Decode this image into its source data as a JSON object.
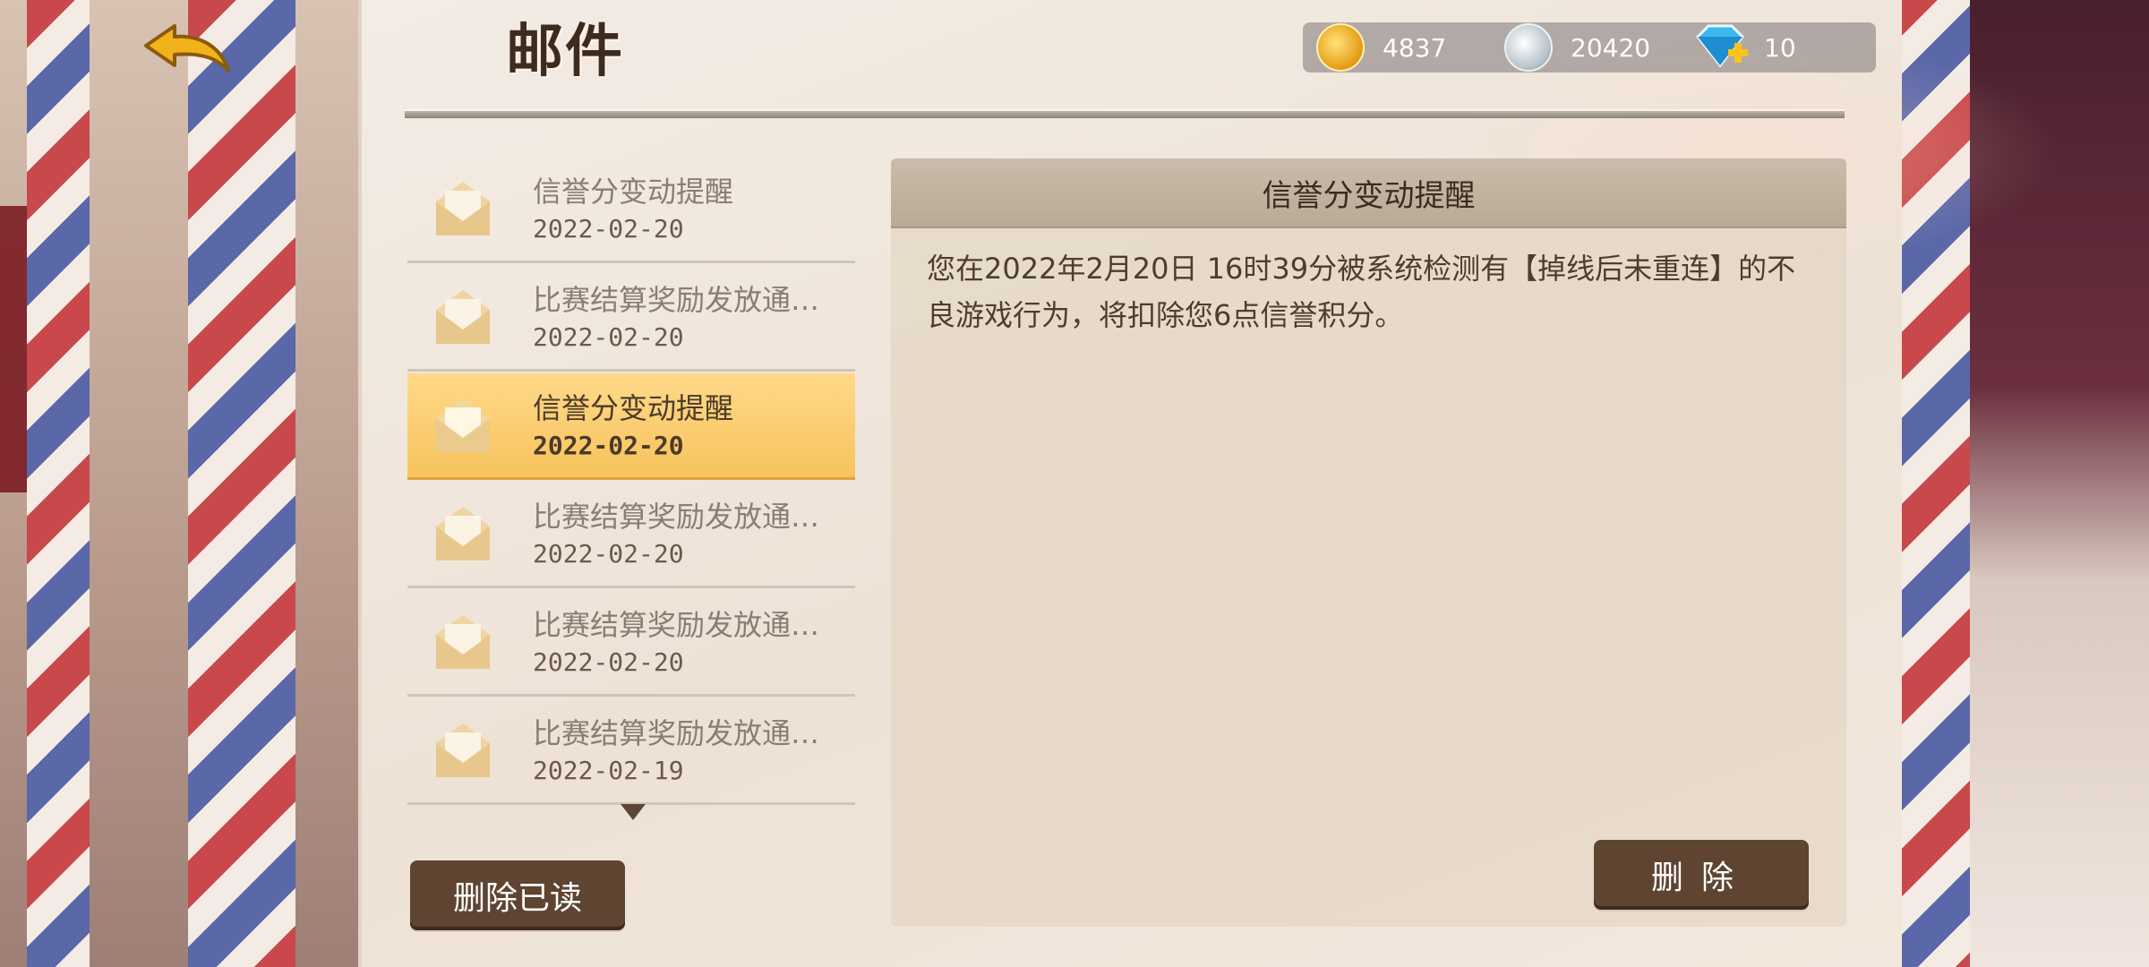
{
  "header": {
    "title": "邮件",
    "back_icon": "back-arrow-icon"
  },
  "currencies": [
    {
      "icon": "gold-coin-icon",
      "value": "4837"
    },
    {
      "icon": "silver-coin-icon",
      "value": "20420"
    },
    {
      "icon": "diamond-plus-icon",
      "value": "10"
    }
  ],
  "mails": [
    {
      "title": "信誉分变动提醒",
      "date": "2022-02-20",
      "selected": false
    },
    {
      "title": "比赛结算奖励发放通…",
      "date": "2022-02-20",
      "selected": false
    },
    {
      "title": "信誉分变动提醒",
      "date": "2022-02-20",
      "selected": true
    },
    {
      "title": "比赛结算奖励发放通…",
      "date": "2022-02-20",
      "selected": false
    },
    {
      "title": "比赛结算奖励发放通…",
      "date": "2022-02-20",
      "selected": false
    },
    {
      "title": "比赛结算奖励发放通…",
      "date": "2022-02-19",
      "selected": false
    }
  ],
  "buttons": {
    "delete_read": "删除已读",
    "delete": "删除"
  },
  "detail": {
    "title": "信誉分变动提醒",
    "body": "您在2022年2月20日 16时39分被系统检测有【掉线后未重连】的不良游戏行为，将扣除您6点信誉积分。"
  },
  "colors": {
    "selected_row": "#f7c35c",
    "button_bg": "#5e4431"
  }
}
